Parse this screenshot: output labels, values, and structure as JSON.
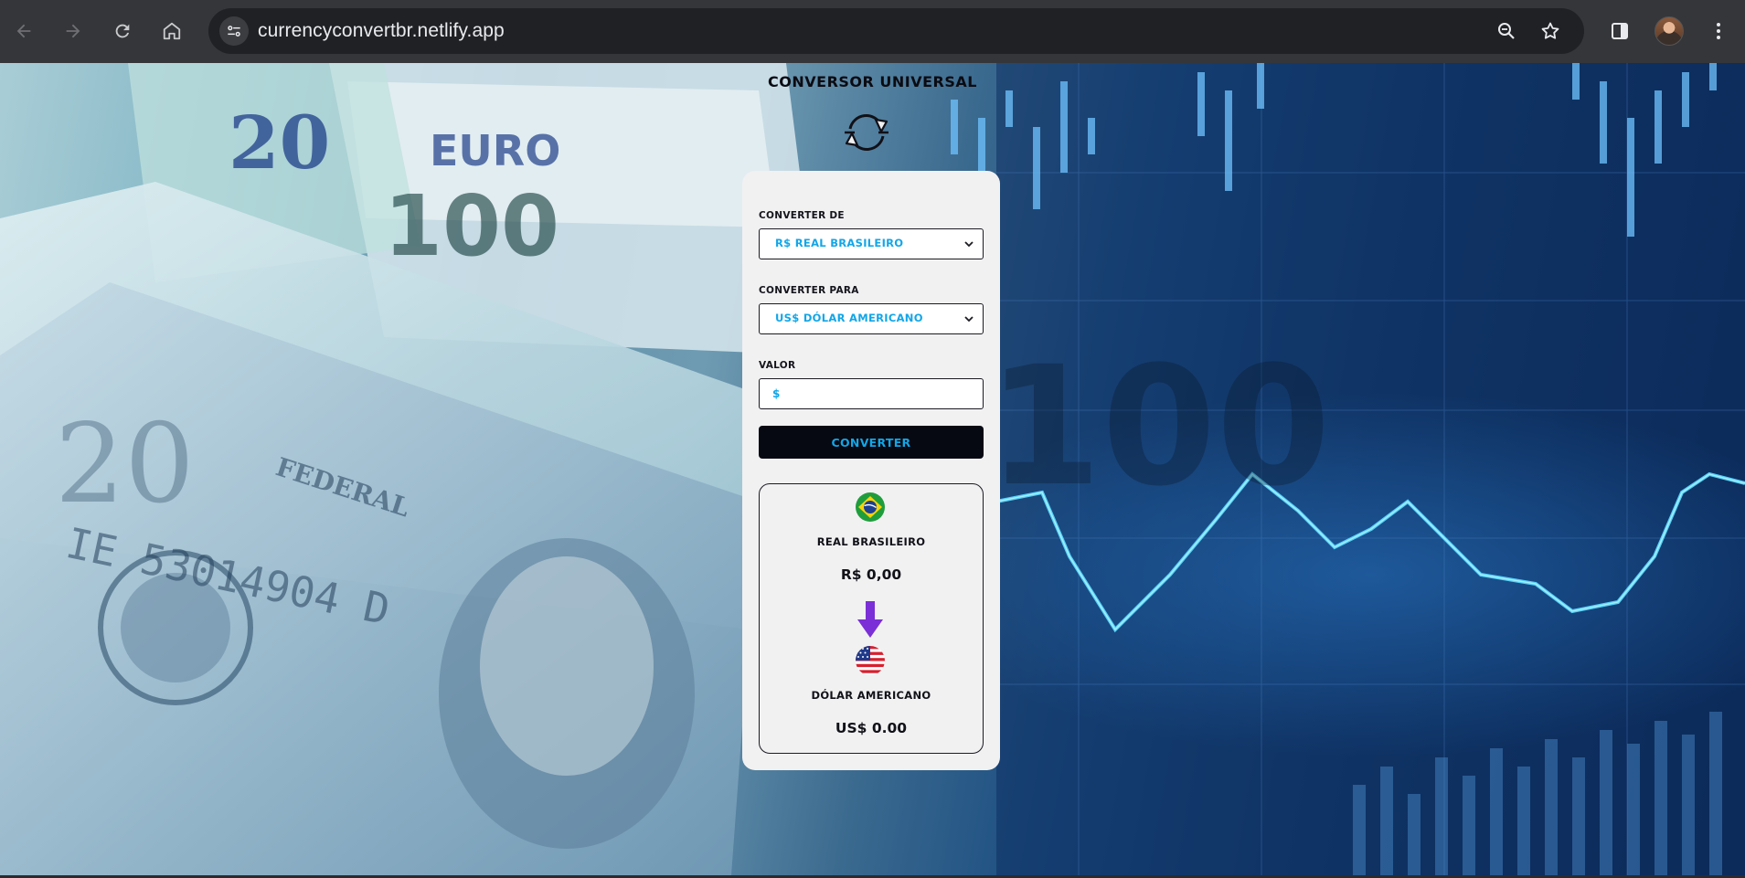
{
  "browser": {
    "url": "currencyconvertbr.netlify.app",
    "icons": [
      "back-arrow-icon",
      "forward-arrow-icon",
      "reload-icon",
      "home-icon",
      "site-settings-icon",
      "zoom-icon",
      "bookmark-star-icon",
      "side-panel-icon",
      "profile-avatar",
      "more-menu-icon"
    ]
  },
  "app": {
    "title": "CONVERSOR UNIVERSAL",
    "from_label": "CONVERTER DE",
    "from_selected": "R$ REAL BRASILEIRO",
    "to_label": "CONVERTER PARA",
    "to_selected": "US$ DÓLAR AMERICANO",
    "value_label": "VALOR",
    "value_placeholder": "$",
    "value_current": "",
    "convert_button": "CONVERTER",
    "accent_color": "#12a6e8",
    "arrow_color": "#7b2fd6",
    "result": {
      "from_currency_name": "REAL BRASILEIRO",
      "from_amount": "R$ 0,00",
      "to_currency_name": "DÓLAR AMERICANO",
      "to_amount": "US$ 0.00"
    }
  }
}
